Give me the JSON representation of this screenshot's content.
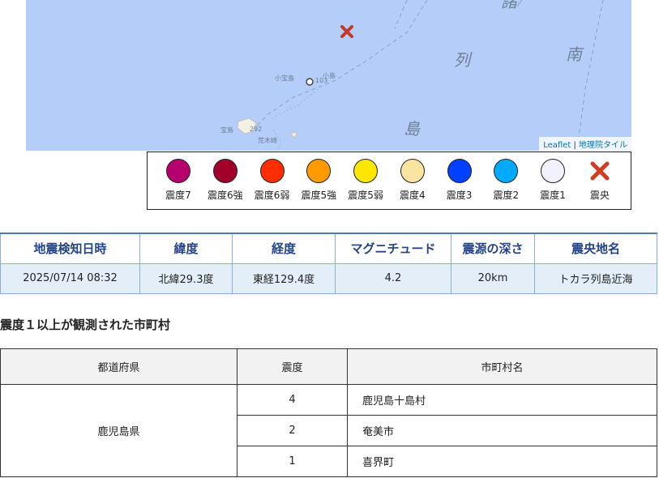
{
  "map": {
    "labels": {
      "kanji_retsu": "列",
      "kanji_shima": "島",
      "kanji_minami": "南",
      "kanji_top": "諸",
      "kodakara": "小宝島",
      "kojima": "小島",
      "takara": "宝島",
      "elev_103": "103",
      "elev_292": "292",
      "arakizaki": "荒木崎"
    },
    "attribution": {
      "leaflet": "Leaflet",
      "separator": " | ",
      "tiles": "地理院タイル"
    },
    "colors": {
      "sea": "#b5cdf9",
      "epicenter": "#c0392b"
    }
  },
  "legend": [
    {
      "label": "震度7",
      "color": "#b5006e"
    },
    {
      "label": "震度6強",
      "color": "#a1002c"
    },
    {
      "label": "震度6弱",
      "color": "#ff2e00"
    },
    {
      "label": "震度5強",
      "color": "#ff9a00"
    },
    {
      "label": "震度5弱",
      "color": "#ffe600"
    },
    {
      "label": "震度4",
      "color": "#fbe4a0"
    },
    {
      "label": "震度3",
      "color": "#0041ff"
    },
    {
      "label": "震度2",
      "color": "#00aaff"
    },
    {
      "label": "震度1",
      "color": "#f2f2ff"
    },
    {
      "label": "震央",
      "icon": "cross-icon",
      "color": "#d63b1f"
    }
  ],
  "quake": {
    "headers": [
      "地震検知日時",
      "緯度",
      "経度",
      "マグニチュード",
      "震源の深さ",
      "震央地名"
    ],
    "values": [
      "2025/07/14 08:32",
      "北緯29.3度",
      "東経129.4度",
      "4.2",
      "20km",
      "トカラ列島近海"
    ]
  },
  "section_title": "震度１以上が観測された市町村",
  "observations": {
    "headers": [
      "都道府県",
      "震度",
      "市町村名"
    ],
    "prefecture": "鹿児島県",
    "rows": [
      {
        "intensity": "4",
        "city": "鹿児島十島村"
      },
      {
        "intensity": "2",
        "city": "奄美市"
      },
      {
        "intensity": "1",
        "city": "喜界町"
      }
    ]
  }
}
